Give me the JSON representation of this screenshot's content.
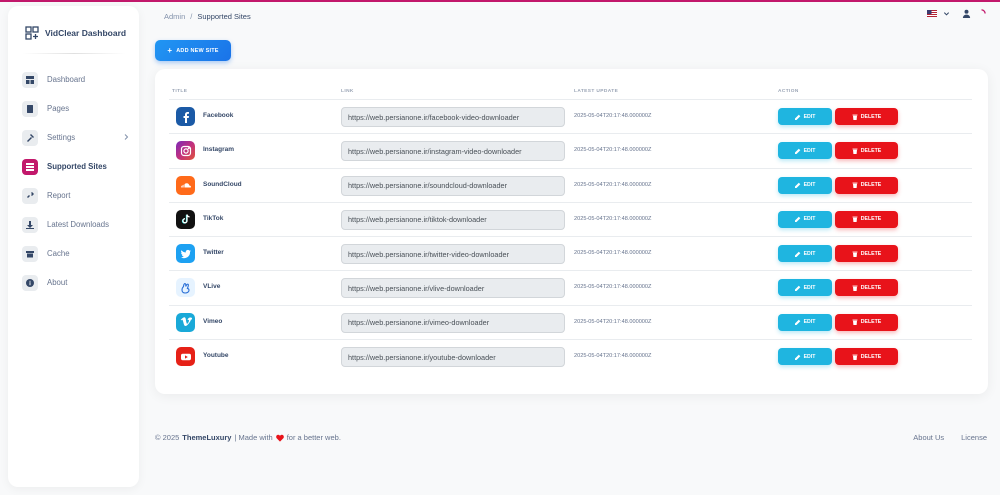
{
  "colors": {
    "accent": "#c2186b",
    "primary": "#1a73e8",
    "info": "#1fb5e0",
    "danger": "#e8131a"
  },
  "brand": {
    "title": "VidClear Dashboard",
    "icon": "dashboard-grid-icon"
  },
  "sidebar": {
    "items": [
      {
        "label": "Dashboard",
        "icon": "dashboard-icon"
      },
      {
        "label": "Pages",
        "icon": "pages-icon"
      },
      {
        "label": "Settings",
        "icon": "tools-icon"
      },
      {
        "label": "Supported Sites",
        "icon": "grid-icon",
        "active": true
      },
      {
        "label": "Report",
        "icon": "link-icon"
      },
      {
        "label": "Latest Downloads",
        "icon": "download-icon"
      },
      {
        "label": "Cache",
        "icon": "archive-icon"
      },
      {
        "label": "About",
        "icon": "info-icon"
      }
    ]
  },
  "breadcrumb": {
    "parent": "Admin",
    "separator": "/",
    "current": "Supported Sites"
  },
  "header": {
    "language_icon": "us-flag-icon",
    "user_icon": "user-icon",
    "loader_icon": "spinner-icon"
  },
  "add_button": {
    "label": "ADD NEW SITE"
  },
  "table": {
    "columns": {
      "title": "TITLE",
      "link": "LINK",
      "updated": "LATEST UPDATE",
      "action": "ACTION"
    },
    "edit_label": "EDIT",
    "delete_label": "DELETE",
    "rows": [
      {
        "name": "Facebook",
        "link": "https://web.persianone.ir/facebook-video-downloader",
        "updated": "2025-05-04T20:17:48.000000Z",
        "icon": "facebook-icon",
        "color": "#1b5aa6"
      },
      {
        "name": "Instagram",
        "link": "https://web.persianone.ir/instagram-video-downloader",
        "updated": "2025-05-04T20:17:48.000000Z",
        "icon": "instagram-icon",
        "color": "#c1307f"
      },
      {
        "name": "SoundCloud",
        "link": "https://web.persianone.ir/soundcloud-downloader",
        "updated": "2025-05-04T20:17:48.000000Z",
        "icon": "soundcloud-icon",
        "color": "#ff6a1a"
      },
      {
        "name": "TikTok",
        "link": "https://web.persianone.ir/tiktok-downloader",
        "updated": "2025-05-04T20:17:48.000000Z",
        "icon": "tiktok-icon",
        "color": "#111111"
      },
      {
        "name": "Twitter",
        "link": "https://web.persianone.ir/twitter-video-downloader",
        "updated": "2025-05-04T20:17:48.000000Z",
        "icon": "twitter-icon",
        "color": "#1da1f2"
      },
      {
        "name": "VLive",
        "link": "https://web.persianone.ir/vlive-downloader",
        "updated": "2025-05-04T20:17:48.000000Z",
        "icon": "vlive-icon",
        "color": "#e6f3ff"
      },
      {
        "name": "Vimeo",
        "link": "https://web.persianone.ir/vimeo-downloader",
        "updated": "2025-05-04T20:17:48.000000Z",
        "icon": "vimeo-icon",
        "color": "#19a9d8"
      },
      {
        "name": "Youtube",
        "link": "https://web.persianone.ir/youtube-downloader",
        "updated": "2025-05-04T20:17:48.000000Z",
        "icon": "youtube-icon",
        "color": "#e62117"
      }
    ]
  },
  "footer": {
    "copyright": "© 2025",
    "author": "ThemeLuxury",
    "made_with": "| Made with",
    "tail": "for a better web.",
    "links": [
      "About Us",
      "License"
    ]
  }
}
